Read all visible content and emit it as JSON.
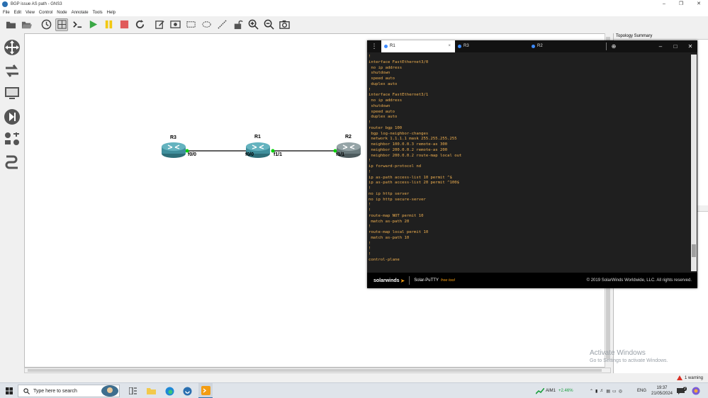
{
  "window": {
    "title": "BGP issue AS path - GNS3"
  },
  "menu": [
    "File",
    "Edit",
    "View",
    "Control",
    "Node",
    "Annotate",
    "Tools",
    "Help"
  ],
  "topology": {
    "routers": [
      {
        "name": "R3",
        "color": "#3f8f9c"
      },
      {
        "name": "R1",
        "color": "#3f8f9c"
      },
      {
        "name": "R2",
        "color": "#6b7b7e"
      }
    ],
    "ports": {
      "r3_f00": "f0/0",
      "r1_f00": "f0/0",
      "r1_f11": "f1/1",
      "r2_f11": "f1/1"
    },
    "link_dot_color": "#00d000"
  },
  "right_panel": {
    "title": "Topology Summary"
  },
  "putty": {
    "tabs": [
      {
        "label": "R1",
        "active": true
      },
      {
        "label": "R3",
        "active": false
      },
      {
        "label": "R2",
        "active": false
      }
    ],
    "lines": [
      "!",
      "interface FastEthernet3/0",
      " no ip address",
      " shutdown",
      " speed auto",
      " duplex auto",
      "!",
      "interface FastEthernet3/1",
      " no ip address",
      " shutdown",
      " speed auto",
      " duplex auto",
      "!",
      "router bgp 100",
      " bgp log-neighbor-changes",
      " network 1.1.1.1 mask 255.255.255.255",
      " neighbor 100.0.0.3 remote-as 300",
      " neighbor 200.0.0.2 remote-as 200",
      " neighbor 200.0.0.2 route-map local out",
      "!",
      "ip forward-protocol nd",
      "!",
      "ip as-path access-list 10 permit ^$",
      "ip as-path access-list 20 permit ^100$",
      "!",
      "no ip http server",
      "no ip http secure-server",
      "!",
      "!",
      "route-map NOT permit 10",
      " match as-path 20",
      "!",
      "route-map local permit 10",
      " match as-path 10",
      "!",
      "!",
      "!",
      "control-plane"
    ],
    "footer_brand": "solarwinds",
    "footer_product": "Solar-PuTTY",
    "footer_free": "free tool",
    "footer_copyright": "© 2019 SolarWinds Worldwide, LLC. All rights reserved.",
    "text_color": "#f0b050"
  },
  "watermark": {
    "line1": "Activate Windows",
    "line2": "Go to Settings to activate Windows."
  },
  "status": {
    "warning": "1 warning"
  },
  "taskbar": {
    "search_placeholder": "Type here to search",
    "stock_name": "AIM1",
    "stock_change": "+2.46%",
    "lang": "ENG",
    "time": "19:37",
    "date": "21/05/2024",
    "notif_count": "2"
  }
}
